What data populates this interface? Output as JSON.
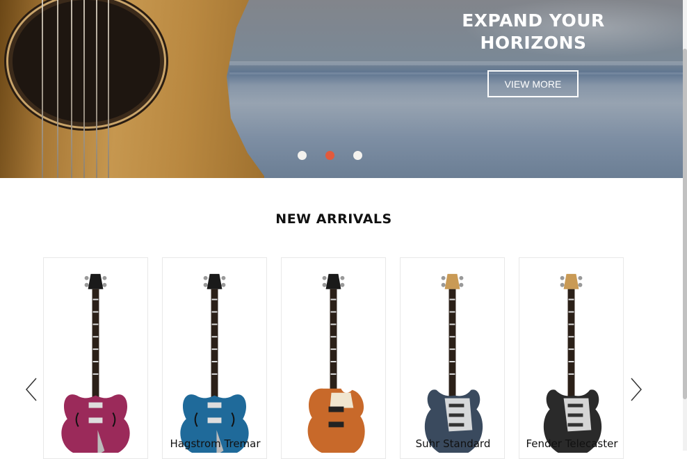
{
  "hero": {
    "title_line1": "EXPAND YOUR",
    "title_line2": "HORIZONS",
    "button_label": "VIEW MORE",
    "slides": 3,
    "active_slide": 2
  },
  "new_arrivals": {
    "title": "NEW ARRIVALS",
    "products": [
      {
        "name": "",
        "body_color": "#9b2a5a",
        "style": "semi-hollow",
        "headstock": "black"
      },
      {
        "name": "Hagstrom Tremar",
        "body_color": "#1f6a9a",
        "style": "semi-hollow",
        "headstock": "black"
      },
      {
        "name": "",
        "body_color": "#c8692a",
        "style": "single-cut",
        "headstock": "black"
      },
      {
        "name": "Suhr Standard",
        "body_color": "#3a4a5e",
        "style": "double-cut",
        "headstock": "maple"
      },
      {
        "name": "Fender Telecaster",
        "body_color": "#2a2a2a",
        "style": "double-cut",
        "headstock": "maple"
      }
    ]
  },
  "colors": {
    "accent_dot": "#e25a3c",
    "text_dark": "#111111"
  },
  "icons": {
    "prev": "chevron-left-icon",
    "next": "chevron-right-icon"
  }
}
